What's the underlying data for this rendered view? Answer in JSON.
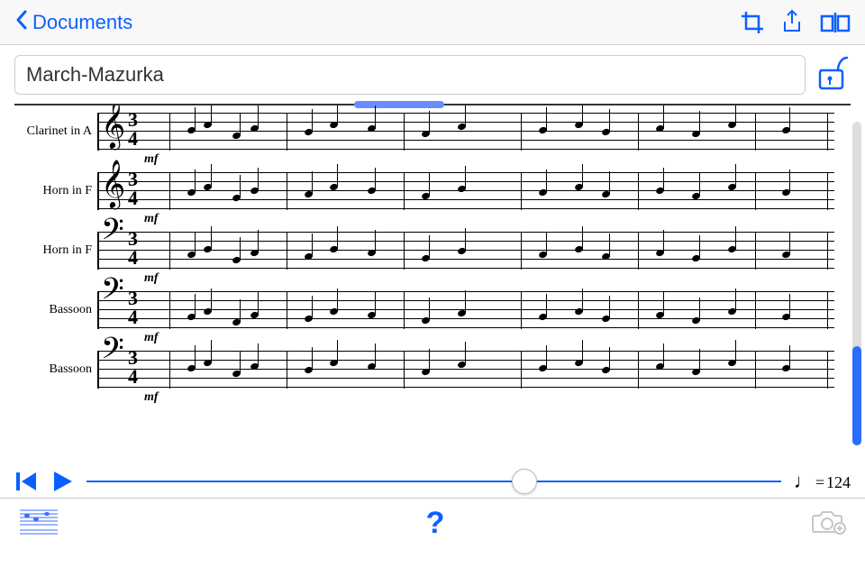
{
  "nav": {
    "back_label": "Documents"
  },
  "document": {
    "title": "March-Mazurka"
  },
  "score": {
    "time_signature": {
      "num": "3",
      "den": "4"
    },
    "dynamic": "mf",
    "instruments": [
      {
        "label": "Clarinet in A",
        "clef": "treble"
      },
      {
        "label": "Horn in F",
        "clef": "treble"
      },
      {
        "label": "Horn in F",
        "clef": "bass"
      },
      {
        "label": "Bassoon",
        "clef": "bass"
      },
      {
        "label": "Bassoon",
        "clef": "bass"
      }
    ]
  },
  "playback": {
    "tempo_value": "124",
    "tempo_eq": "= "
  },
  "bottom": {
    "help": "?"
  }
}
